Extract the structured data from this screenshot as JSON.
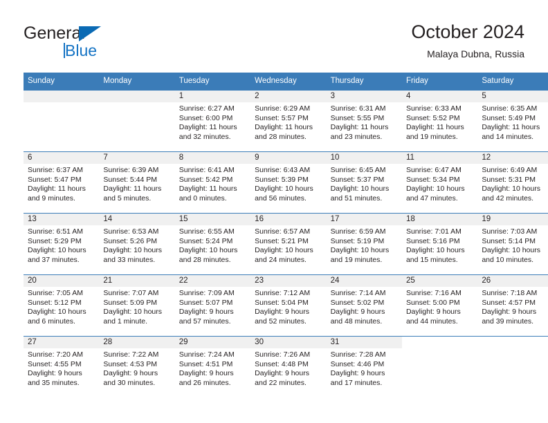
{
  "brand": {
    "name_line1": "General",
    "name_line2": "Blue",
    "logo_icon": "triangle-flag-icon",
    "accent_color": "#1473c4"
  },
  "header": {
    "title": "October 2024",
    "subtitle": "Malaya Dubna, Russia"
  },
  "calendar": {
    "header_bg": "#3b7cb8",
    "daynum_bg": "#f0f0f0",
    "weekdays": [
      "Sunday",
      "Monday",
      "Tuesday",
      "Wednesday",
      "Thursday",
      "Friday",
      "Saturday"
    ],
    "weeks": [
      [
        {
          "day": "",
          "lines": []
        },
        {
          "day": "",
          "lines": []
        },
        {
          "day": "1",
          "lines": [
            "Sunrise: 6:27 AM",
            "Sunset: 6:00 PM",
            "Daylight: 11 hours",
            "and 32 minutes."
          ]
        },
        {
          "day": "2",
          "lines": [
            "Sunrise: 6:29 AM",
            "Sunset: 5:57 PM",
            "Daylight: 11 hours",
            "and 28 minutes."
          ]
        },
        {
          "day": "3",
          "lines": [
            "Sunrise: 6:31 AM",
            "Sunset: 5:55 PM",
            "Daylight: 11 hours",
            "and 23 minutes."
          ]
        },
        {
          "day": "4",
          "lines": [
            "Sunrise: 6:33 AM",
            "Sunset: 5:52 PM",
            "Daylight: 11 hours",
            "and 19 minutes."
          ]
        },
        {
          "day": "5",
          "lines": [
            "Sunrise: 6:35 AM",
            "Sunset: 5:49 PM",
            "Daylight: 11 hours",
            "and 14 minutes."
          ]
        }
      ],
      [
        {
          "day": "6",
          "lines": [
            "Sunrise: 6:37 AM",
            "Sunset: 5:47 PM",
            "Daylight: 11 hours",
            "and 9 minutes."
          ]
        },
        {
          "day": "7",
          "lines": [
            "Sunrise: 6:39 AM",
            "Sunset: 5:44 PM",
            "Daylight: 11 hours",
            "and 5 minutes."
          ]
        },
        {
          "day": "8",
          "lines": [
            "Sunrise: 6:41 AM",
            "Sunset: 5:42 PM",
            "Daylight: 11 hours",
            "and 0 minutes."
          ]
        },
        {
          "day": "9",
          "lines": [
            "Sunrise: 6:43 AM",
            "Sunset: 5:39 PM",
            "Daylight: 10 hours",
            "and 56 minutes."
          ]
        },
        {
          "day": "10",
          "lines": [
            "Sunrise: 6:45 AM",
            "Sunset: 5:37 PM",
            "Daylight: 10 hours",
            "and 51 minutes."
          ]
        },
        {
          "day": "11",
          "lines": [
            "Sunrise: 6:47 AM",
            "Sunset: 5:34 PM",
            "Daylight: 10 hours",
            "and 47 minutes."
          ]
        },
        {
          "day": "12",
          "lines": [
            "Sunrise: 6:49 AM",
            "Sunset: 5:31 PM",
            "Daylight: 10 hours",
            "and 42 minutes."
          ]
        }
      ],
      [
        {
          "day": "13",
          "lines": [
            "Sunrise: 6:51 AM",
            "Sunset: 5:29 PM",
            "Daylight: 10 hours",
            "and 37 minutes."
          ]
        },
        {
          "day": "14",
          "lines": [
            "Sunrise: 6:53 AM",
            "Sunset: 5:26 PM",
            "Daylight: 10 hours",
            "and 33 minutes."
          ]
        },
        {
          "day": "15",
          "lines": [
            "Sunrise: 6:55 AM",
            "Sunset: 5:24 PM",
            "Daylight: 10 hours",
            "and 28 minutes."
          ]
        },
        {
          "day": "16",
          "lines": [
            "Sunrise: 6:57 AM",
            "Sunset: 5:21 PM",
            "Daylight: 10 hours",
            "and 24 minutes."
          ]
        },
        {
          "day": "17",
          "lines": [
            "Sunrise: 6:59 AM",
            "Sunset: 5:19 PM",
            "Daylight: 10 hours",
            "and 19 minutes."
          ]
        },
        {
          "day": "18",
          "lines": [
            "Sunrise: 7:01 AM",
            "Sunset: 5:16 PM",
            "Daylight: 10 hours",
            "and 15 minutes."
          ]
        },
        {
          "day": "19",
          "lines": [
            "Sunrise: 7:03 AM",
            "Sunset: 5:14 PM",
            "Daylight: 10 hours",
            "and 10 minutes."
          ]
        }
      ],
      [
        {
          "day": "20",
          "lines": [
            "Sunrise: 7:05 AM",
            "Sunset: 5:12 PM",
            "Daylight: 10 hours",
            "and 6 minutes."
          ]
        },
        {
          "day": "21",
          "lines": [
            "Sunrise: 7:07 AM",
            "Sunset: 5:09 PM",
            "Daylight: 10 hours",
            "and 1 minute."
          ]
        },
        {
          "day": "22",
          "lines": [
            "Sunrise: 7:09 AM",
            "Sunset: 5:07 PM",
            "Daylight: 9 hours",
            "and 57 minutes."
          ]
        },
        {
          "day": "23",
          "lines": [
            "Sunrise: 7:12 AM",
            "Sunset: 5:04 PM",
            "Daylight: 9 hours",
            "and 52 minutes."
          ]
        },
        {
          "day": "24",
          "lines": [
            "Sunrise: 7:14 AM",
            "Sunset: 5:02 PM",
            "Daylight: 9 hours",
            "and 48 minutes."
          ]
        },
        {
          "day": "25",
          "lines": [
            "Sunrise: 7:16 AM",
            "Sunset: 5:00 PM",
            "Daylight: 9 hours",
            "and 44 minutes."
          ]
        },
        {
          "day": "26",
          "lines": [
            "Sunrise: 7:18 AM",
            "Sunset: 4:57 PM",
            "Daylight: 9 hours",
            "and 39 minutes."
          ]
        }
      ],
      [
        {
          "day": "27",
          "lines": [
            "Sunrise: 7:20 AM",
            "Sunset: 4:55 PM",
            "Daylight: 9 hours",
            "and 35 minutes."
          ]
        },
        {
          "day": "28",
          "lines": [
            "Sunrise: 7:22 AM",
            "Sunset: 4:53 PM",
            "Daylight: 9 hours",
            "and 30 minutes."
          ]
        },
        {
          "day": "29",
          "lines": [
            "Sunrise: 7:24 AM",
            "Sunset: 4:51 PM",
            "Daylight: 9 hours",
            "and 26 minutes."
          ]
        },
        {
          "day": "30",
          "lines": [
            "Sunrise: 7:26 AM",
            "Sunset: 4:48 PM",
            "Daylight: 9 hours",
            "and 22 minutes."
          ]
        },
        {
          "day": "31",
          "lines": [
            "Sunrise: 7:28 AM",
            "Sunset: 4:46 PM",
            "Daylight: 9 hours",
            "and 17 minutes."
          ]
        },
        {
          "day": "",
          "lines": []
        },
        {
          "day": "",
          "lines": []
        }
      ]
    ]
  }
}
